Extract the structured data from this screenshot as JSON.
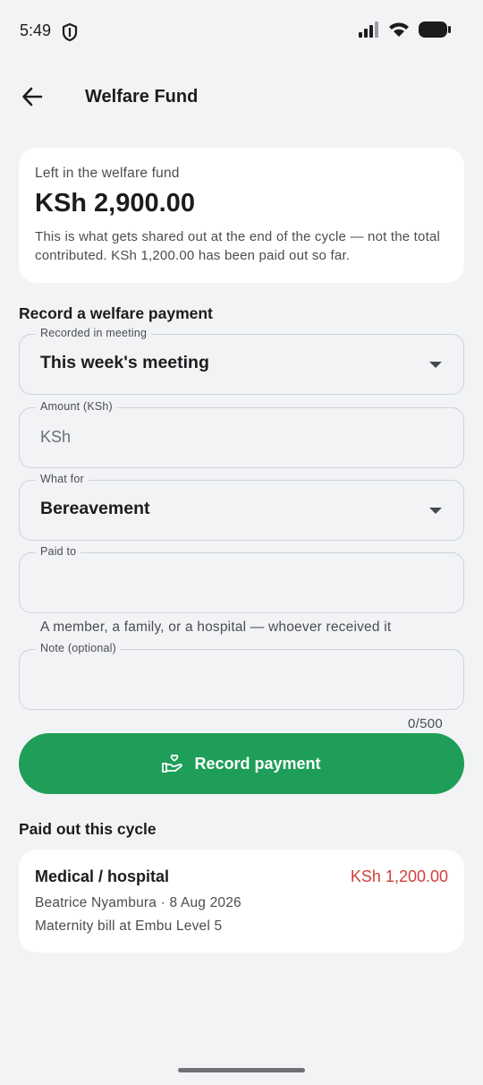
{
  "status_bar": {
    "time": "5:49",
    "icons": [
      "shield-icon",
      "signal-icon",
      "wifi-icon",
      "battery-icon"
    ]
  },
  "app_bar": {
    "back_icon": "arrow-back-icon",
    "title": "Welfare Fund"
  },
  "summary": {
    "label": "Left in the welfare fund",
    "amount": "KSh 2,900.00",
    "note": "This is what gets shared out at the end of the cycle — not the total contributed. KSh 1,200.00 has been paid out so far."
  },
  "form": {
    "heading": "Record a welfare payment",
    "meeting": {
      "label": "Recorded in meeting",
      "value": "This week's meeting"
    },
    "amount": {
      "label": "Amount (KSh)",
      "placeholder": "KSh",
      "value": ""
    },
    "purpose": {
      "label": "What for",
      "value": "Bereavement"
    },
    "paid_to": {
      "label": "Paid to",
      "value": "",
      "helper": "A member, a family, or a hospital — whoever received it"
    },
    "note": {
      "label": "Note (optional)",
      "value": "",
      "counter": "0/500"
    },
    "submit_label": "Record payment",
    "submit_icon": "hand-heart-icon"
  },
  "payouts": {
    "heading": "Paid out this cycle",
    "items": [
      {
        "category": "Medical / hospital",
        "amount": "KSh 1,200.00",
        "meta": "Beatrice Nyambura · 8 Aug 2026",
        "note": "Maternity bill at Embu Level 5"
      }
    ]
  },
  "colors": {
    "accent": "#1e9e58",
    "negative": "#d0413a",
    "background": "#f2f3f5",
    "card": "#ffffff"
  }
}
